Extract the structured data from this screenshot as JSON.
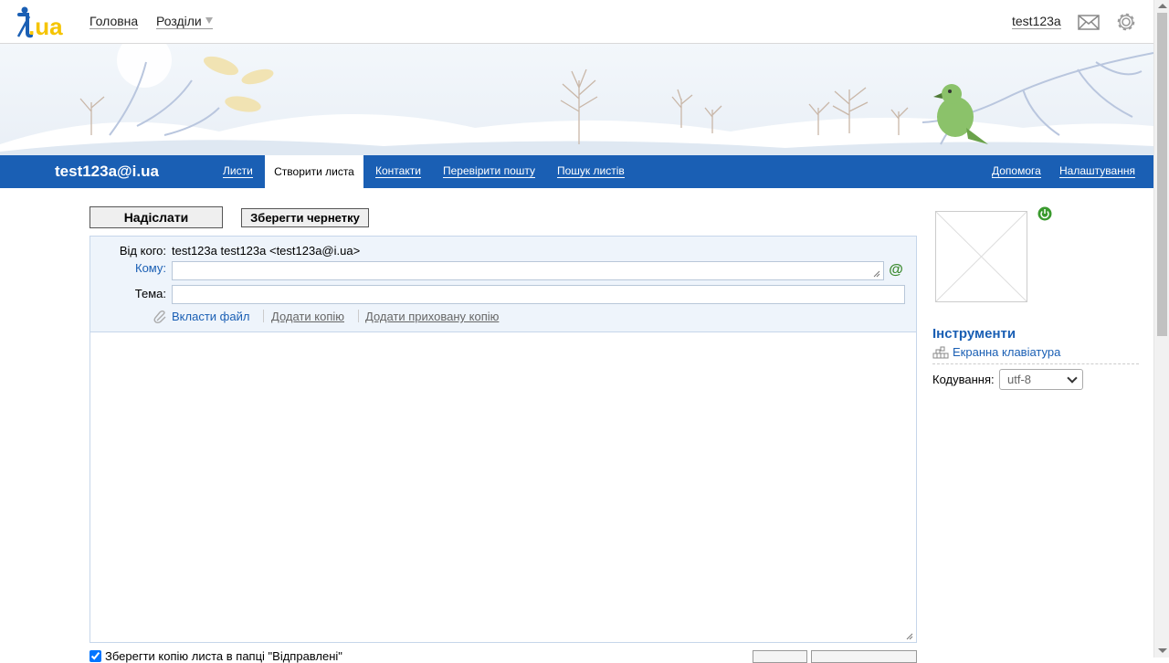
{
  "header": {
    "logo_text": "i.ua",
    "nav": {
      "home": "Головна",
      "sections": "Розділи"
    },
    "username": "test123a"
  },
  "navbar": {
    "account": "test123a@i.ua",
    "items": [
      "Листи",
      "Створити листа",
      "Контакти",
      "Перевірити пошту",
      "Пошук листів"
    ],
    "right": [
      "Допомога",
      "Налаштування"
    ],
    "active": "Створити листа"
  },
  "compose": {
    "send_label": "Надіслати",
    "draft_label": "Зберегти чернетку",
    "from_label": "Від кого:",
    "from_value": "test123a test123a <test123a@i.ua>",
    "to_label": "Кому:",
    "to_value": "",
    "subject_label": "Тема:",
    "subject_value": "",
    "attach_label": "Вкласти файл",
    "add_cc": "Додати копію",
    "add_bcc": "Додати приховану копію",
    "body_value": "",
    "save_copy_label": "Зберегти копію листа в папці \"Відправлені\"",
    "save_copy_checked": true
  },
  "sidebar": {
    "tools_title": "Інструменти",
    "keyboard_link": "Екранна клавіатура",
    "encoding_label": "Кодування:",
    "encoding_value": "utf-8"
  },
  "colors": {
    "accent": "#1a5fb4",
    "header_bg": "#eef4fb",
    "logo_yellow": "#f5c400"
  },
  "icons": [
    "mail-icon",
    "gear-icon",
    "power-icon",
    "at-icon",
    "paperclip-icon",
    "keyboard-icon",
    "chevron-down-icon"
  ]
}
